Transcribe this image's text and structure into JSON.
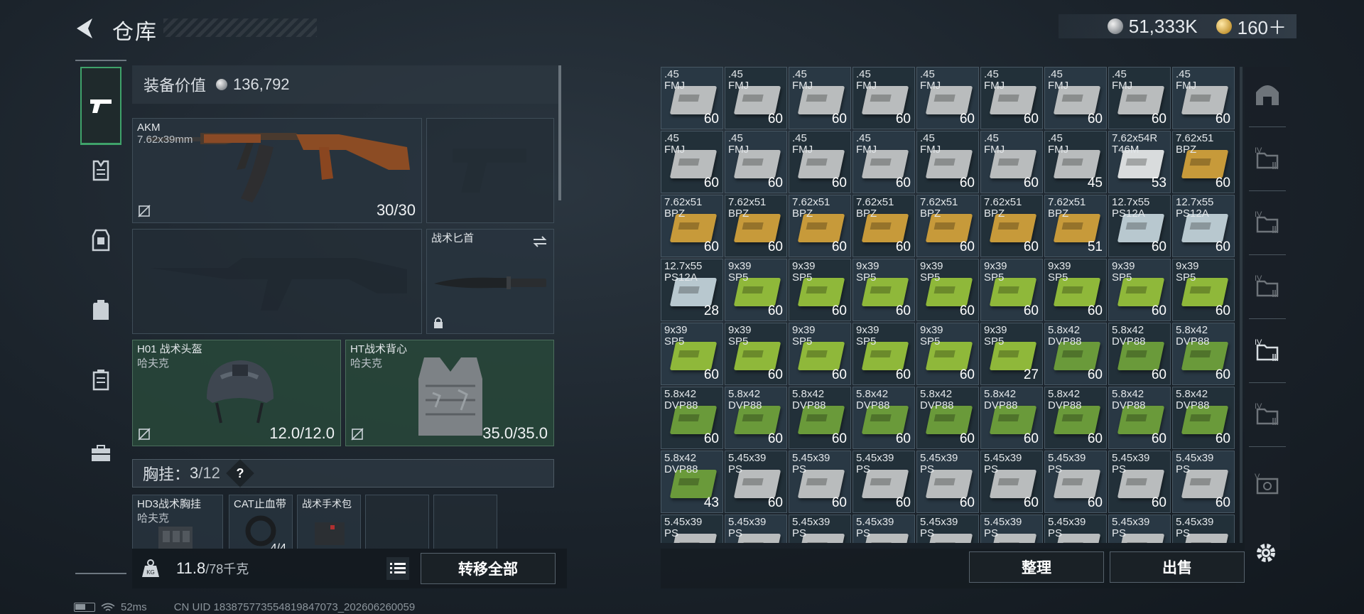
{
  "header": {
    "title": "仓库",
    "currency": [
      {
        "icon": "silver-coin-icon",
        "value": "51,333K"
      },
      {
        "icon": "gold-coin-icon",
        "value": "160＋"
      }
    ]
  },
  "left_nav": [
    {
      "name": "nav-weapons",
      "icon": "pistol-icon",
      "active": true
    },
    {
      "name": "nav-armor",
      "icon": "vest-icon",
      "active": false
    },
    {
      "name": "nav-rig",
      "icon": "chest-rig-icon",
      "active": false
    },
    {
      "name": "nav-backpack",
      "icon": "backpack-icon",
      "active": false
    },
    {
      "name": "nav-pouch",
      "icon": "pouch-icon",
      "active": false
    },
    {
      "name": "nav-case",
      "icon": "case-icon",
      "active": false
    }
  ],
  "equipment": {
    "value_label": "装备价值",
    "value": "136,792",
    "primary": {
      "name": "AKM",
      "caliber": "7.62x39mm",
      "count": "30/30"
    },
    "knife": {
      "name": "战术匕首"
    },
    "helmet": {
      "name": "H01 战术头盔",
      "brand": "哈夫克",
      "durability": "12.0/12.0"
    },
    "vest": {
      "name": "HT战术背心",
      "brand": "哈夫克",
      "durability": "35.0/35.0"
    },
    "chest": {
      "label": "胸挂：",
      "current": "3",
      "max": "/12",
      "help": "?"
    },
    "chest_items": [
      {
        "name": "HD3战术胸挂",
        "brand": "哈夫克"
      },
      {
        "name": "CAT止血带",
        "count": "4/4"
      },
      {
        "name": "战术手术包"
      }
    ]
  },
  "weight": {
    "current": "11.8",
    "max": "/78千克"
  },
  "buttons": {
    "transfer_all": "转移全部",
    "sort": "整理",
    "sell": "出售"
  },
  "status_bar": {
    "ping": "52ms",
    "uid": "CN UID 18387577355481984​7073_202606260059"
  },
  "grid": {
    "rows": [
      [
        {
          "a": ".45",
          "b": "FMJ",
          "q": "60",
          "c": "silver"
        },
        {
          "a": ".45",
          "b": "FMJ",
          "q": "60",
          "c": "silver"
        },
        {
          "a": ".45",
          "b": "FMJ",
          "q": "60",
          "c": "silver"
        },
        {
          "a": ".45",
          "b": "FMJ",
          "q": "60",
          "c": "silver"
        },
        {
          "a": ".45",
          "b": "FMJ",
          "q": "60",
          "c": "silver"
        },
        {
          "a": ".45",
          "b": "FMJ",
          "q": "60",
          "c": "silver"
        },
        {
          "a": ".45",
          "b": "FMJ",
          "q": "60",
          "c": "silver"
        },
        {
          "a": ".45",
          "b": "FMJ",
          "q": "60",
          "c": "silver"
        },
        {
          "a": ".45",
          "b": "FMJ",
          "q": "60",
          "c": "silver"
        }
      ],
      [
        {
          "a": ".45",
          "b": "FMJ",
          "q": "60",
          "c": "silver"
        },
        {
          "a": ".45",
          "b": "FMJ",
          "q": "60",
          "c": "silver"
        },
        {
          "a": ".45",
          "b": "FMJ",
          "q": "60",
          "c": "silver"
        },
        {
          "a": ".45",
          "b": "FMJ",
          "q": "60",
          "c": "silver"
        },
        {
          "a": ".45",
          "b": "FMJ",
          "q": "60",
          "c": "silver"
        },
        {
          "a": ".45",
          "b": "FMJ",
          "q": "60",
          "c": "silver"
        },
        {
          "a": ".45",
          "b": "FMJ",
          "q": "45",
          "c": "silver"
        },
        {
          "a": "7.62x54R",
          "b": "T46M",
          "q": "53",
          "c": "white"
        },
        {
          "a": "7.62x51",
          "b": "BPZ",
          "q": "60",
          "c": "gold"
        }
      ],
      [
        {
          "a": "7.62x51",
          "b": "BPZ",
          "q": "60",
          "c": "gold"
        },
        {
          "a": "7.62x51",
          "b": "BPZ",
          "q": "60",
          "c": "gold"
        },
        {
          "a": "7.62x51",
          "b": "BPZ",
          "q": "60",
          "c": "gold"
        },
        {
          "a": "7.62x51",
          "b": "BPZ",
          "q": "60",
          "c": "gold"
        },
        {
          "a": "7.62x51",
          "b": "BPZ",
          "q": "60",
          "c": "gold"
        },
        {
          "a": "7.62x51",
          "b": "BPZ",
          "q": "60",
          "c": "gold"
        },
        {
          "a": "7.62x51",
          "b": "BPZ",
          "q": "51",
          "c": "gold"
        },
        {
          "a": "12.7x55",
          "b": "PS12A",
          "q": "60",
          "c": "blue"
        },
        {
          "a": "12.7x55",
          "b": "PS12A",
          "q": "60",
          "c": "blue"
        }
      ],
      [
        {
          "a": "12.7x55",
          "b": "PS12A",
          "q": "28",
          "c": "blue"
        },
        {
          "a": "9x39",
          "b": "SP5",
          "q": "60",
          "c": "green"
        },
        {
          "a": "9x39",
          "b": "SP5",
          "q": "60",
          "c": "green"
        },
        {
          "a": "9x39",
          "b": "SP5",
          "q": "60",
          "c": "green"
        },
        {
          "a": "9x39",
          "b": "SP5",
          "q": "60",
          "c": "green"
        },
        {
          "a": "9x39",
          "b": "SP5",
          "q": "60",
          "c": "green"
        },
        {
          "a": "9x39",
          "b": "SP5",
          "q": "60",
          "c": "green"
        },
        {
          "a": "9x39",
          "b": "SP5",
          "q": "60",
          "c": "green"
        },
        {
          "a": "9x39",
          "b": "SP5",
          "q": "60",
          "c": "green"
        }
      ],
      [
        {
          "a": "9x39",
          "b": "SP5",
          "q": "60",
          "c": "green"
        },
        {
          "a": "9x39",
          "b": "SP5",
          "q": "60",
          "c": "green"
        },
        {
          "a": "9x39",
          "b": "SP5",
          "q": "60",
          "c": "green"
        },
        {
          "a": "9x39",
          "b": "SP5",
          "q": "60",
          "c": "green"
        },
        {
          "a": "9x39",
          "b": "SP5",
          "q": "60",
          "c": "green"
        },
        {
          "a": "9x39",
          "b": "SP5",
          "q": "27",
          "c": "green"
        },
        {
          "a": "5.8x42",
          "b": "DVP88",
          "q": "60",
          "c": "green2"
        },
        {
          "a": "5.8x42",
          "b": "DVP88",
          "q": "60",
          "c": "green2"
        },
        {
          "a": "5.8x42",
          "b": "DVP88",
          "q": "60",
          "c": "green2"
        }
      ],
      [
        {
          "a": "5.8x42",
          "b": "DVP88",
          "q": "60",
          "c": "green2"
        },
        {
          "a": "5.8x42",
          "b": "DVP88",
          "q": "60",
          "c": "green2"
        },
        {
          "a": "5.8x42",
          "b": "DVP88",
          "q": "60",
          "c": "green2"
        },
        {
          "a": "5.8x42",
          "b": "DVP88",
          "q": "60",
          "c": "green2"
        },
        {
          "a": "5.8x42",
          "b": "DVP88",
          "q": "60",
          "c": "green2"
        },
        {
          "a": "5.8x42",
          "b": "DVP88",
          "q": "60",
          "c": "green2"
        },
        {
          "a": "5.8x42",
          "b": "DVP88",
          "q": "60",
          "c": "green2"
        },
        {
          "a": "5.8x42",
          "b": "DVP88",
          "q": "60",
          "c": "green2"
        },
        {
          "a": "5.8x42",
          "b": "DVP88",
          "q": "60",
          "c": "green2"
        }
      ],
      [
        {
          "a": "5.8x42",
          "b": "DVP88",
          "q": "43",
          "c": "green2"
        },
        {
          "a": "5.45x39",
          "b": "PS",
          "q": "60",
          "c": "silver"
        },
        {
          "a": "5.45x39",
          "b": "PS",
          "q": "60",
          "c": "silver"
        },
        {
          "a": "5.45x39",
          "b": "PS",
          "q": "60",
          "c": "silver"
        },
        {
          "a": "5.45x39",
          "b": "PS",
          "q": "60",
          "c": "silver"
        },
        {
          "a": "5.45x39",
          "b": "PS",
          "q": "60",
          "c": "silver"
        },
        {
          "a": "5.45x39",
          "b": "PS",
          "q": "60",
          "c": "silver"
        },
        {
          "a": "5.45x39",
          "b": "PS",
          "q": "60",
          "c": "silver"
        },
        {
          "a": "5.45x39",
          "b": "PS",
          "q": "60",
          "c": "silver"
        }
      ],
      [
        {
          "a": "5.45x39",
          "b": "PS",
          "q": "",
          "c": "silver"
        },
        {
          "a": "5.45x39",
          "b": "PS",
          "q": "",
          "c": "silver"
        },
        {
          "a": "5.45x39",
          "b": "PS",
          "q": "",
          "c": "silver"
        },
        {
          "a": "5.45x39",
          "b": "PS",
          "q": "",
          "c": "silver"
        },
        {
          "a": "5.45x39",
          "b": "PS",
          "q": "",
          "c": "silver"
        },
        {
          "a": "5.45x39",
          "b": "PS",
          "q": "",
          "c": "silver"
        },
        {
          "a": "5.45x39",
          "b": "PS",
          "q": "",
          "c": "silver"
        },
        {
          "a": "5.45x39",
          "b": "PS",
          "q": "",
          "c": "silver"
        },
        {
          "a": "5.45x39",
          "b": "PS",
          "q": "",
          "c": "silver"
        }
      ]
    ],
    "colors": {
      "silver": "#b9bcbd",
      "white": "#d9dcdd",
      "gold": "#c79a3a",
      "blue": "#b8c8cf",
      "green": "#8fb83a",
      "green2": "#6a9a3a"
    }
  },
  "right_tabs": [
    {
      "name": "tab-all",
      "icon": "helmet-outline-icon",
      "active": false
    },
    {
      "name": "tab-iv-1",
      "icon": "folder-iv-icon",
      "active": false
    },
    {
      "name": "tab-iv-2",
      "icon": "folder-iv-icon",
      "active": false
    },
    {
      "name": "tab-iv-3",
      "icon": "folder-iv-icon",
      "active": false
    },
    {
      "name": "tab-iv-4",
      "icon": "folder-iv-icon",
      "active": true
    },
    {
      "name": "tab-iv-5",
      "icon": "folder-iv-icon",
      "active": false
    },
    {
      "name": "tab-v",
      "icon": "safe-v-icon",
      "active": false
    }
  ]
}
